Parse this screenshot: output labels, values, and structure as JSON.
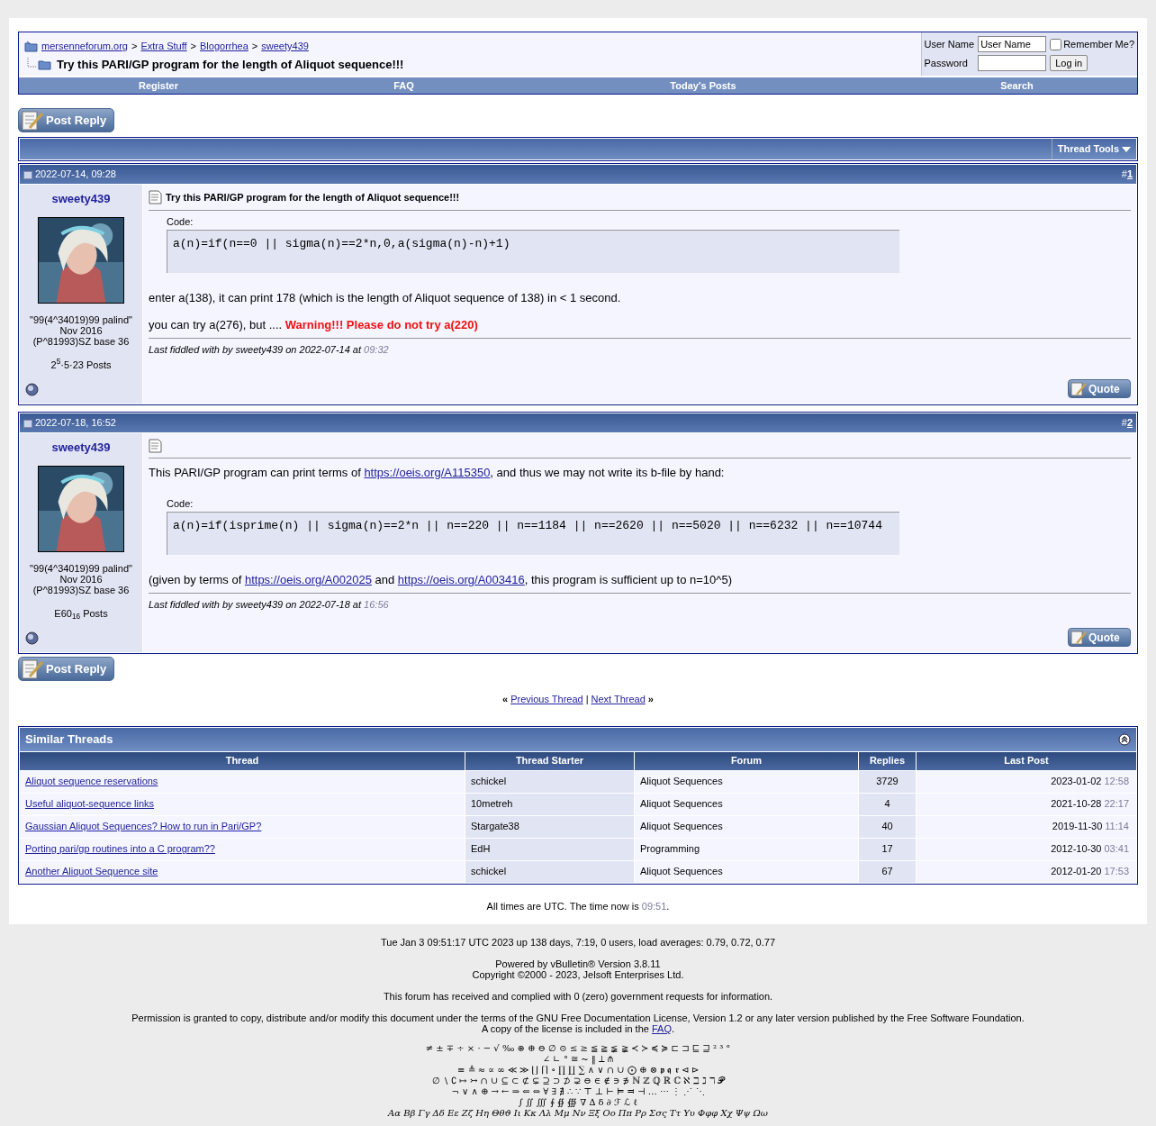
{
  "breadcrumb": {
    "links": [
      "mersenneforum.org",
      "Extra Stuff",
      "Blogorrhea",
      "sweety439"
    ],
    "separator": ">",
    "title": "Try this PARI/GP program for the length of Aliquot sequence!!!"
  },
  "login": {
    "user_label": "User Name",
    "user_value": "User Name",
    "remember_label": "Remember Me?",
    "remember_checked": false,
    "password_label": "Password",
    "button": "Log in"
  },
  "navbar": [
    "Register",
    "FAQ",
    "Today's Posts",
    "Search"
  ],
  "post_reply_top": "Post Reply",
  "post_reply_bottom": "Post Reply",
  "thread_tools": "Thread Tools",
  "posts": [
    {
      "date": "2022-07-14, 09:28",
      "hash": "#",
      "number": "1",
      "author": "sweety439",
      "user_lines": [
        "\"99(4^34019)99 palind\"",
        "Nov 2016",
        "(P^81993)SZ base 36"
      ],
      "post_count": "2$^{5}$·5·23 Posts",
      "title": "Try this PARI/GP program for the length of Aliquot sequence!!!",
      "body": [
        {
          "kind": "code",
          "label": "Code:",
          "code": "a(n)=if(n==0 || sigma(n)==2*n,0,a(sigma(n)-n)+1)"
        },
        {
          "kind": "paragraph",
          "segments": [
            {
              "kind": "text",
              "text": "enter a(138), it can print 178 (which is the length of Aliquot sequence of 138) in < 1 second."
            }
          ]
        },
        {
          "kind": "paragraph",
          "segments": [
            {
              "kind": "text",
              "text": "you can try a(276), but .... "
            },
            {
              "kind": "warning",
              "text": "Warning!!! Please do not try a(220)"
            }
          ]
        }
      ],
      "edit": {
        "text": "Last fiddled with by sweety439 on 2022-07-14 at ",
        "time": "09:32"
      },
      "quote": "Quote"
    },
    {
      "date": "2022-07-18, 16:52",
      "hash": "#",
      "number": "2",
      "author": "sweety439",
      "user_lines": [
        "\"99(4^34019)99 palind\"",
        "Nov 2016",
        "(P^81993)SZ base 36"
      ],
      "post_count": "E60$_{16}$ Posts",
      "body": [
        {
          "kind": "paragraph",
          "segments": [
            {
              "kind": "text",
              "text": "This PARI/GP program can print terms of "
            },
            {
              "kind": "link",
              "text": "https://oeis.org/A115350"
            },
            {
              "kind": "text",
              "text": ", and thus we may not write its b-file by hand:"
            }
          ]
        },
        {
          "kind": "code",
          "label": "Code:",
          "code": "a(n)=if(isprime(n) || sigma(n)==2*n || n==220 || n==1184 || n==2620 || n==5020 || n==6232 || n==10744"
        },
        {
          "kind": "paragraph",
          "segments": [
            {
              "kind": "text",
              "text": "(given by terms of "
            },
            {
              "kind": "link",
              "text": "https://oeis.org/A002025"
            },
            {
              "kind": "text",
              "text": " and "
            },
            {
              "kind": "link",
              "text": "https://oeis.org/A003416"
            },
            {
              "kind": "text",
              "text": ", this program is sufficient up to n=10^5)"
            }
          ]
        }
      ],
      "edit": {
        "text": "Last fiddled with by sweety439 on 2022-07-18 at ",
        "time": "16:56"
      },
      "quote": "Quote"
    }
  ],
  "thread_nav": {
    "left": "«",
    "prev": "Previous Thread",
    "sep": "|",
    "next": "Next Thread",
    "right": "»"
  },
  "similar_threads": {
    "title": "Similar Threads",
    "columns": [
      "Thread",
      "Thread Starter",
      "Forum",
      "Replies",
      "Last Post"
    ],
    "rows": [
      {
        "thread": "Aliquot sequence reservations",
        "starter": "schickel",
        "forum": "Aliquot Sequences",
        "replies": "3729",
        "date": "2023-01-02",
        "time": "12:58"
      },
      {
        "thread": "Useful aliquot-sequence links",
        "starter": "10metreh",
        "forum": "Aliquot Sequences",
        "replies": "4",
        "date": "2021-10-28",
        "time": "22:17"
      },
      {
        "thread": "Gaussian Aliquot Sequences? How to run in Pari/GP?",
        "starter": "Stargate38",
        "forum": "Aliquot Sequences",
        "replies": "40",
        "date": "2019-11-30",
        "time": "11:14"
      },
      {
        "thread": "Porting pari/gp routines into a C program??",
        "starter": "EdH",
        "forum": "Programming",
        "replies": "17",
        "date": "2012-10-30",
        "time": "03:41"
      },
      {
        "thread": "Another Aliquot Sequence site",
        "starter": "schickel",
        "forum": "Aliquot Sequences",
        "replies": "67",
        "date": "2012-01-20",
        "time": "17:53"
      }
    ]
  },
  "time_note": {
    "text": "All times are UTC. The time now is ",
    "time": "09:51",
    "end": "."
  },
  "footer": {
    "uptime": "Tue Jan 3 09:51:17 UTC 2023 up 138 days, 7:19, 0 users, load averages: 0.79, 0.72, 0.77",
    "powered": [
      "Powered by vBulletin® Version 3.8.11",
      "Copyright ©2000 - 2023, Jelsoft Enterprises Ltd."
    ],
    "notice": "This forum has received and complied with 0 (zero) government requests for information.",
    "permission": "Permission is granted to copy, distribute and/or modify this document under the terms of the GNU Free Documentation License, Version 1.2 or any later version published by the Free Software Foundation.",
    "license_text": "A copy of the license is included in the ",
    "license_link": "FAQ",
    "license_end": ".",
    "symbols": [
      "≠ ± ∓ ÷ × · − √ ‰ ⊛ ⊕ ⊖ ∅ ⊙ ≤ ≥ ≦ ≧ ≨ ≩ ≺ ≻ ≼ ≽ ⊏ ⊐ ⊑ ⊒ ² ³ °",
      "∠ ∟ ° ≅ ~ ‖ ⟂ ⫛",
      "≡ ≜ ≈ ∝ ∞ ≪ ≫ ⌊⌋ ⌈⌉ ∘ ∏ ∐ ∑ ∧ ∨ ∩ ∪ ⨀ ⊕ ⊗ 𝖕 𝖖 𝖗 ⊲ ⊳",
      "∅ ∖ ∁ ↦ ↣ ∩ ∪ ⊆ ⊂ ⊄ ⊊ ⊇ ⊃ ⊅ ⊋ ⊖ ∈ ∉ ∋ ∌ ℕ ℤ ℚ ℝ ℂ ℵ ℶ ℷ ℸ 𝓟",
      "¬ ∨ ∧ ⊕ → ← ⇒ ⇐ ⇔ ∀ ∃ ∄ ∴ ∵ ⊤ ⊥ ⊢ ⊨ ⫤ ⊣ … ⋯ ⋮ ⋰ ⋱",
      "∫ ∬ ∭ ∮ ∯ ∰ ∇ ∆ δ ∂ ℱ ℒ ℓ",
      "Αα Ββ Γγ Δδ Εε Ζζ Ηη Θθϑ Ιι Κκ Λλ Μμ Νν Ξξ Οο Ππ Ρρ Σσς Ττ Υυ Φφφ Χχ Ψψ Ωω"
    ]
  }
}
